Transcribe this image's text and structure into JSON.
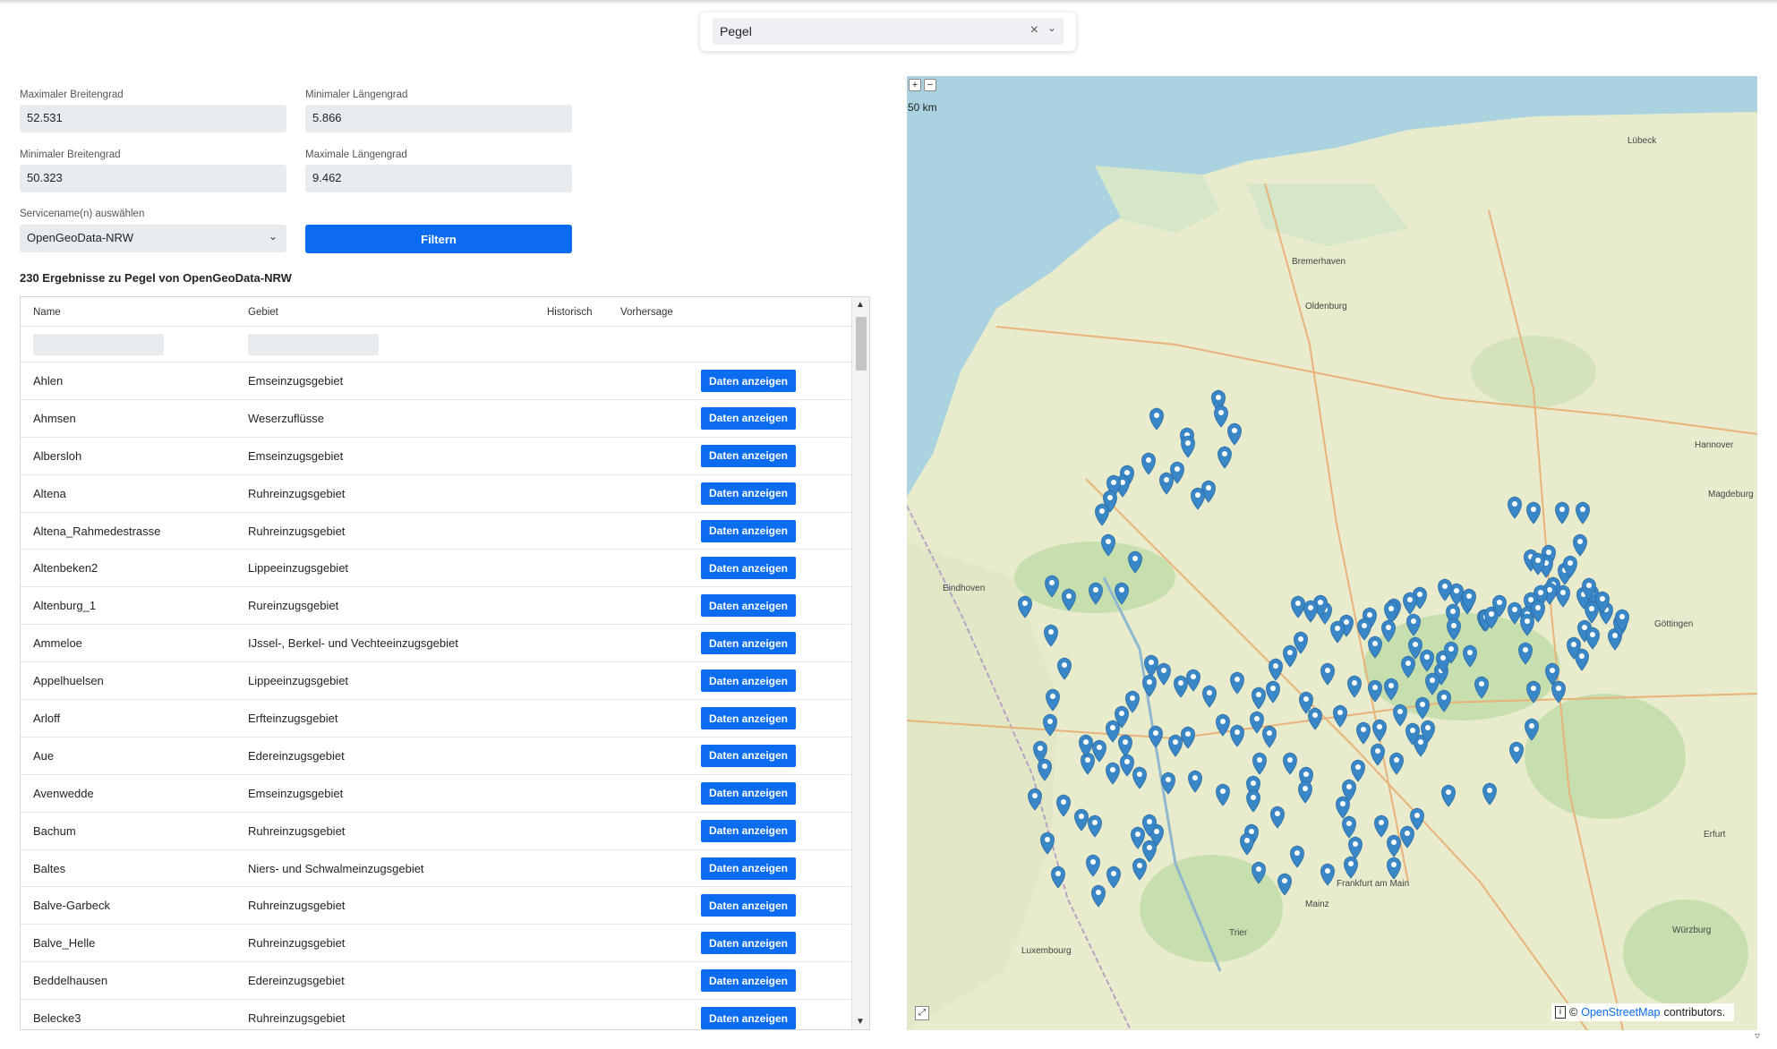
{
  "search": {
    "value": "Pegel",
    "clear_icon": "close-icon",
    "expand_icon": "chevron-down-icon"
  },
  "filters": {
    "max_lat_label": "Maximaler Breitengrad",
    "max_lat_value": "52.531",
    "min_lon_label": "Minimaler Längengrad",
    "min_lon_value": "5.866",
    "min_lat_label": "Minimaler Breitengrad",
    "min_lat_value": "50.323",
    "max_lon_label": "Maximale Längengrad",
    "max_lon_value": "9.462",
    "service_label": "Servicename(n) auswählen",
    "service_value": "OpenGeoData-NRW",
    "filter_button": "Filtern"
  },
  "results": {
    "title": "230 Ergebnisse zu Pegel von OpenGeoData-NRW",
    "columns": {
      "name": "Name",
      "area": "Gebiet",
      "historic": "Historisch",
      "forecast": "Vorhersage"
    },
    "button_label": "Daten anzeigen",
    "rows": [
      {
        "name": "Ahlen",
        "area": "Emseinzugsgebiet"
      },
      {
        "name": "Ahmsen",
        "area": "Weserzuflüsse"
      },
      {
        "name": "Albersloh",
        "area": "Emseinzugsgebiet"
      },
      {
        "name": "Altena",
        "area": "Ruhreinzugsgebiet"
      },
      {
        "name": "Altena_Rahmedestrasse",
        "area": "Ruhreinzugsgebiet"
      },
      {
        "name": "Altenbeken2",
        "area": "Lippeeinzugsgebiet"
      },
      {
        "name": "Altenburg_1",
        "area": "Rureinzugsgebiet"
      },
      {
        "name": "Ammeloe",
        "area": "IJssel-, Berkel- und Vechteeinzugsgebiet"
      },
      {
        "name": "Appelhuelsen",
        "area": "Lippeeinzugsgebiet"
      },
      {
        "name": "Arloff",
        "area": "Erfteinzugsgebiet"
      },
      {
        "name": "Aue",
        "area": "Edereinzugsgebiet"
      },
      {
        "name": "Avenwedde",
        "area": "Emseinzugsgebiet"
      },
      {
        "name": "Bachum",
        "area": "Ruhreinzugsgebiet"
      },
      {
        "name": "Baltes",
        "area": "Niers- und Schwalmeinzugsgebiet"
      },
      {
        "name": "Balve-Garbeck",
        "area": "Ruhreinzugsgebiet"
      },
      {
        "name": "Balve_Helle",
        "area": "Ruhreinzugsgebiet"
      },
      {
        "name": "Beddelhausen",
        "area": "Edereinzugsgebiet"
      },
      {
        "name": "Belecke3",
        "area": "Ruhreinzugsgebiet"
      }
    ]
  },
  "map": {
    "scale": "50 km",
    "zoom_in": "+",
    "zoom_out": "−",
    "fullscreen": "⤢",
    "attribution_info": "i",
    "attribution_copy": "©",
    "attribution_link": "OpenStreetMap",
    "attribution_suffix": "contributors.",
    "colors": {
      "sea": "#aad3df",
      "land": "#e8eccd",
      "forest": "#c7dfae",
      "marker": "#3a87c8"
    },
    "city_labels": [
      "Hannover",
      "Magdeburg",
      "Oldenburg",
      "Bremerhaven",
      "Göttingen",
      "Erfurt",
      "Frankfurt am Main",
      "Mainz",
      "Luxembourg",
      "Eindhoven",
      "Lübeck",
      "Würzburg",
      "Trier"
    ]
  }
}
